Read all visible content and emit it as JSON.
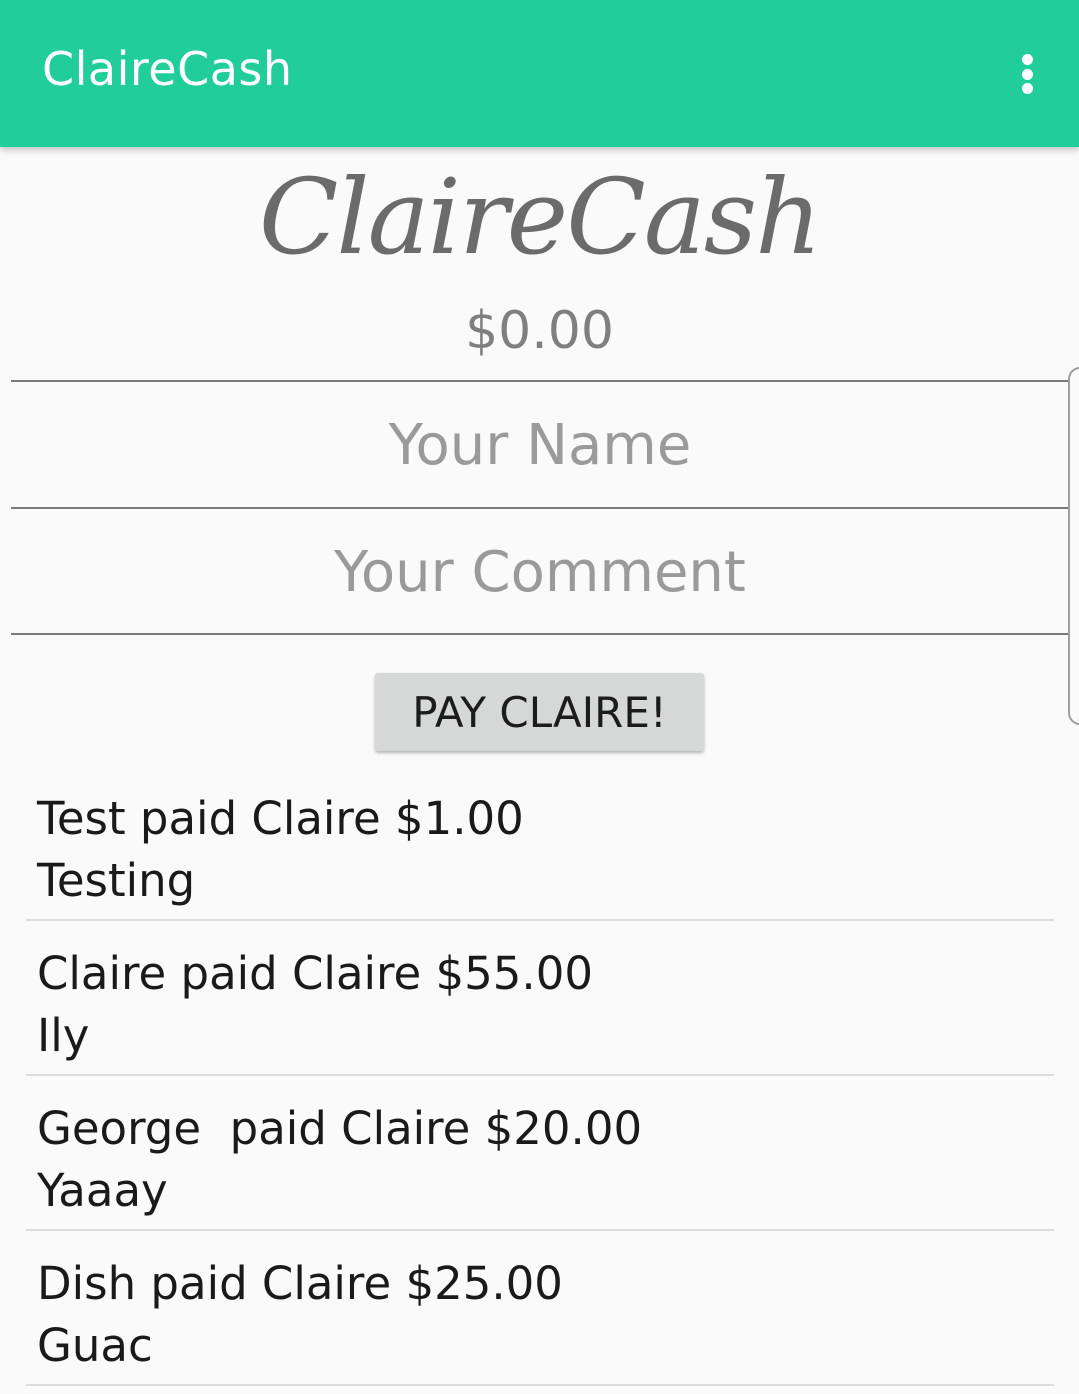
{
  "app_bar": {
    "title": "ClaireCash",
    "menu_icon": "overflow-menu-icon"
  },
  "header": {
    "logo_text": "ClaireCash",
    "balance": "$0.00"
  },
  "form": {
    "name_placeholder": "Your Name",
    "comment_placeholder": "Your Comment",
    "pay_button_label": "PAY CLAIRE!"
  },
  "transactions": [
    {
      "summary": "Test paid Claire $1.00",
      "comment": "Testing"
    },
    {
      "summary": "Claire paid Claire $55.00",
      "comment": "Ily"
    },
    {
      "summary": "George  paid Claire $20.00",
      "comment": "Yaaay"
    },
    {
      "summary": "Dish paid Claire $25.00",
      "comment": "Guac"
    }
  ],
  "colors": {
    "primary": "#21ce99",
    "background": "#fafafa",
    "button": "#d6d7d7"
  }
}
